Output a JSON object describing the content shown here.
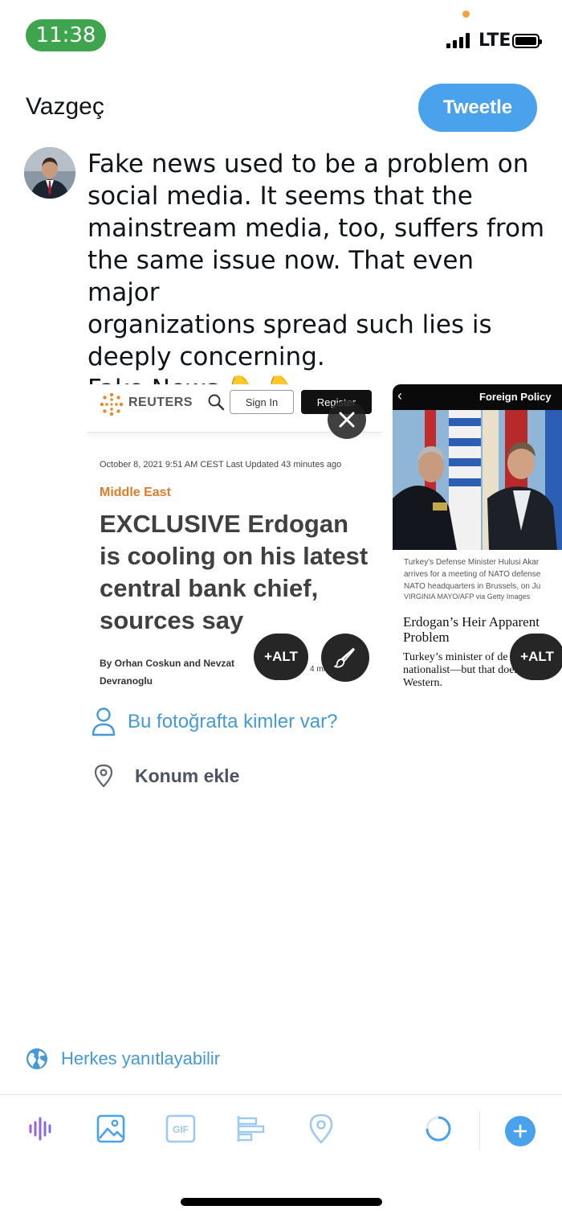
{
  "status_bar": {
    "time": "11:38",
    "network": "LTE"
  },
  "header": {
    "cancel_label": "Vazgeç",
    "tweet_label": "Tweetle"
  },
  "composer": {
    "text": "Fake news used to be a problem on\nsocial media. It seems that the\nmainstream media, too, suffers from\nthe same issue now. That even major\norganizations spread such lies is\ndeeply concerning.\nFake News 👇 👇"
  },
  "media": [
    {
      "brand": "REUTERS",
      "sign_in": "Sign In",
      "register": "Register",
      "date": "October 8, 2021 9:51 AM CEST Last Updated 43 minutes ago",
      "category": "Middle East",
      "headline": "EXCLUSIVE Erdogan\nis cooling on his latest\ncentral bank chief,\nsources say",
      "byline": "By Orhan Coskun and Nevzat Devranoglu",
      "read_time": "4 minute read",
      "alt_label": "+ALT"
    },
    {
      "brand": "Foreign Policy",
      "caption": "Turkey's Defense Minister Hulusi Akar\narrives for a meeting of NATO defense\nNATO headquarters in Brussels, on Ju",
      "credit": "VIRGINIA MAYO/AFP via Getty Images",
      "headline": "Erdogan’s Heir Apparent\nProblem",
      "body": "Turkey’s minister of de        a\nnationalist—but that doesn’t me\nWestern.",
      "alt_label": "+ALT"
    }
  ],
  "tag_people_label": "Bu fotoğrafta kimler var?",
  "location_label": "Konum ekle",
  "reply_setting_label": "Herkes yanıtlayabilir",
  "colors": {
    "accent": "#4aa1ec",
    "link": "#4599d6",
    "time_pill": "#3ea44e",
    "reuters_orange": "#de7c2b"
  },
  "toolbar": [
    "voice-icon",
    "image-icon",
    "gif-icon",
    "poll-icon",
    "location-icon",
    "character-progress-icon",
    "add-thread-icon"
  ]
}
